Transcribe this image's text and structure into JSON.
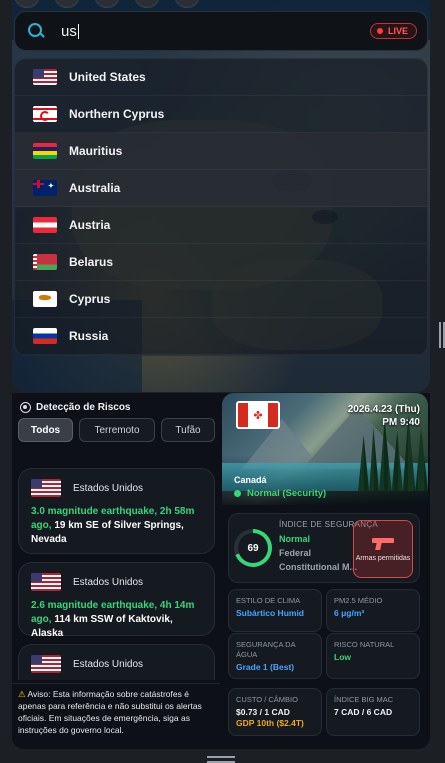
{
  "search": {
    "value": "us",
    "live_label": "LIVE"
  },
  "dropdown": [
    {
      "name": "United States",
      "flag": "us"
    },
    {
      "name": "Northern Cyprus",
      "flag": "ncy"
    },
    {
      "name": "Mauritius",
      "flag": "mu"
    },
    {
      "name": "Australia",
      "flag": "au"
    },
    {
      "name": "Austria",
      "flag": "at"
    },
    {
      "name": "Belarus",
      "flag": "by"
    },
    {
      "name": "Cyprus",
      "flag": "cy"
    },
    {
      "name": "Russia",
      "flag": "ru"
    }
  ],
  "risk_panel": {
    "title": "Detecção de Riscos",
    "tabs": [
      "Todos",
      "Terremoto",
      "Tufão"
    ],
    "cards": [
      {
        "country": "Estados Unidos",
        "highlight": "3.0 magnitude earthquake, 2h 58m ago,",
        "detail": " 19 km SE of Silver Springs, Nevada"
      },
      {
        "country": "Estados Unidos",
        "highlight": "2.6 magnitude earthquake, 4h 14m ago,",
        "detail": " 114 km SSW of Kaktovik, Alaska"
      },
      {
        "country": "Estados Unidos",
        "highlight": "",
        "detail": ""
      }
    ],
    "warning": "Aviso: Esta informação sobre catástrofes é apenas para referência e não substitui os alertas oficiais. Em situações de emergência, siga as instruções do governo local."
  },
  "country_panel": {
    "date": "2026.4.23 (Thu)",
    "time": "PM 9:40",
    "country": "Canadá",
    "status": "Normal (Security)",
    "safety": {
      "label": "ÍNDICE DE SEGURANÇA",
      "score": "69",
      "score_value": 0.69,
      "lines": [
        "Normal",
        "Federal",
        "Constitutional M..."
      ],
      "arms_label": "Armas permitidas"
    },
    "stats": [
      {
        "label": "ESTILO DE CLIMA",
        "value": "Subártico Humid",
        "color": "blue"
      },
      {
        "label": "PM2.5 MÉDIO",
        "value": "6 μg/m³",
        "color": "blue"
      },
      {
        "label": "SEGURANÇA DA ÁGUA",
        "value": "Grade 1 (Best)",
        "color": "blue"
      },
      {
        "label": "RISCO NATURAL",
        "value": "Low",
        "color": "lgreen"
      },
      {
        "label": "CUSTO / CÂMBIO",
        "value": "$0.73 / 1 CAD",
        "value2": "GDP 10th ($2.4T)",
        "color": "white"
      },
      {
        "label": "ÍNDICE BIG MAC",
        "value": "7 CAD / 6 CAD",
        "color": "white"
      }
    ]
  },
  "colors": {
    "accent": "#2fb3d4",
    "live": "#ff3b3b",
    "green": "#36d67a",
    "blue": "#4aa3ff",
    "orange": "#f5a623"
  }
}
